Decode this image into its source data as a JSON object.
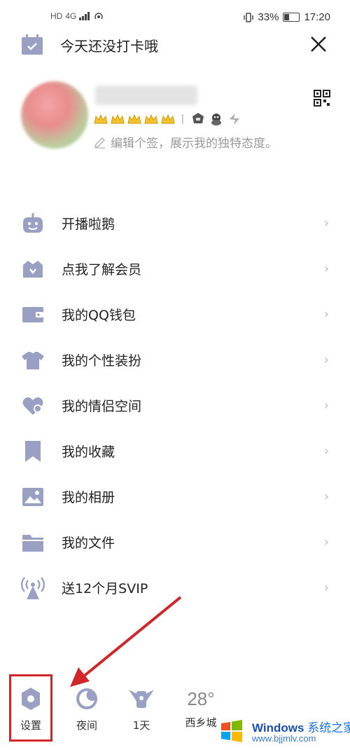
{
  "status": {
    "left_label": "HD",
    "network": "4G",
    "battery": "33%",
    "time": "17:20"
  },
  "checkin": {
    "text": "今天还没打卡哦"
  },
  "profile": {
    "signature": "编辑个签，展示我的独特态度。"
  },
  "menu": [
    {
      "label": "开播啦鹅",
      "icon": "robot-icon"
    },
    {
      "label": "点我了解会员",
      "icon": "vip-crown-icon"
    },
    {
      "label": "我的QQ钱包",
      "icon": "wallet-icon"
    },
    {
      "label": "我的个性装扮",
      "icon": "shirt-icon"
    },
    {
      "label": "我的情侣空间",
      "icon": "heart-icon"
    },
    {
      "label": "我的收藏",
      "icon": "bookmark-icon"
    },
    {
      "label": "我的相册",
      "icon": "photo-icon"
    },
    {
      "label": "我的文件",
      "icon": "folder-icon"
    },
    {
      "label": "送12个月SVIP",
      "icon": "broadcast-icon"
    }
  ],
  "bottom_bar": {
    "settings": "设置",
    "night": "夜间",
    "days": "1天",
    "temperature": "28°",
    "location": "西乡城"
  },
  "watermark": {
    "title": "Windows",
    "title_cn": "系统之家",
    "url": "www.bjjmlv.com"
  },
  "colors": {
    "icon": "#9aa0c4",
    "highlight": "#d1272b"
  }
}
